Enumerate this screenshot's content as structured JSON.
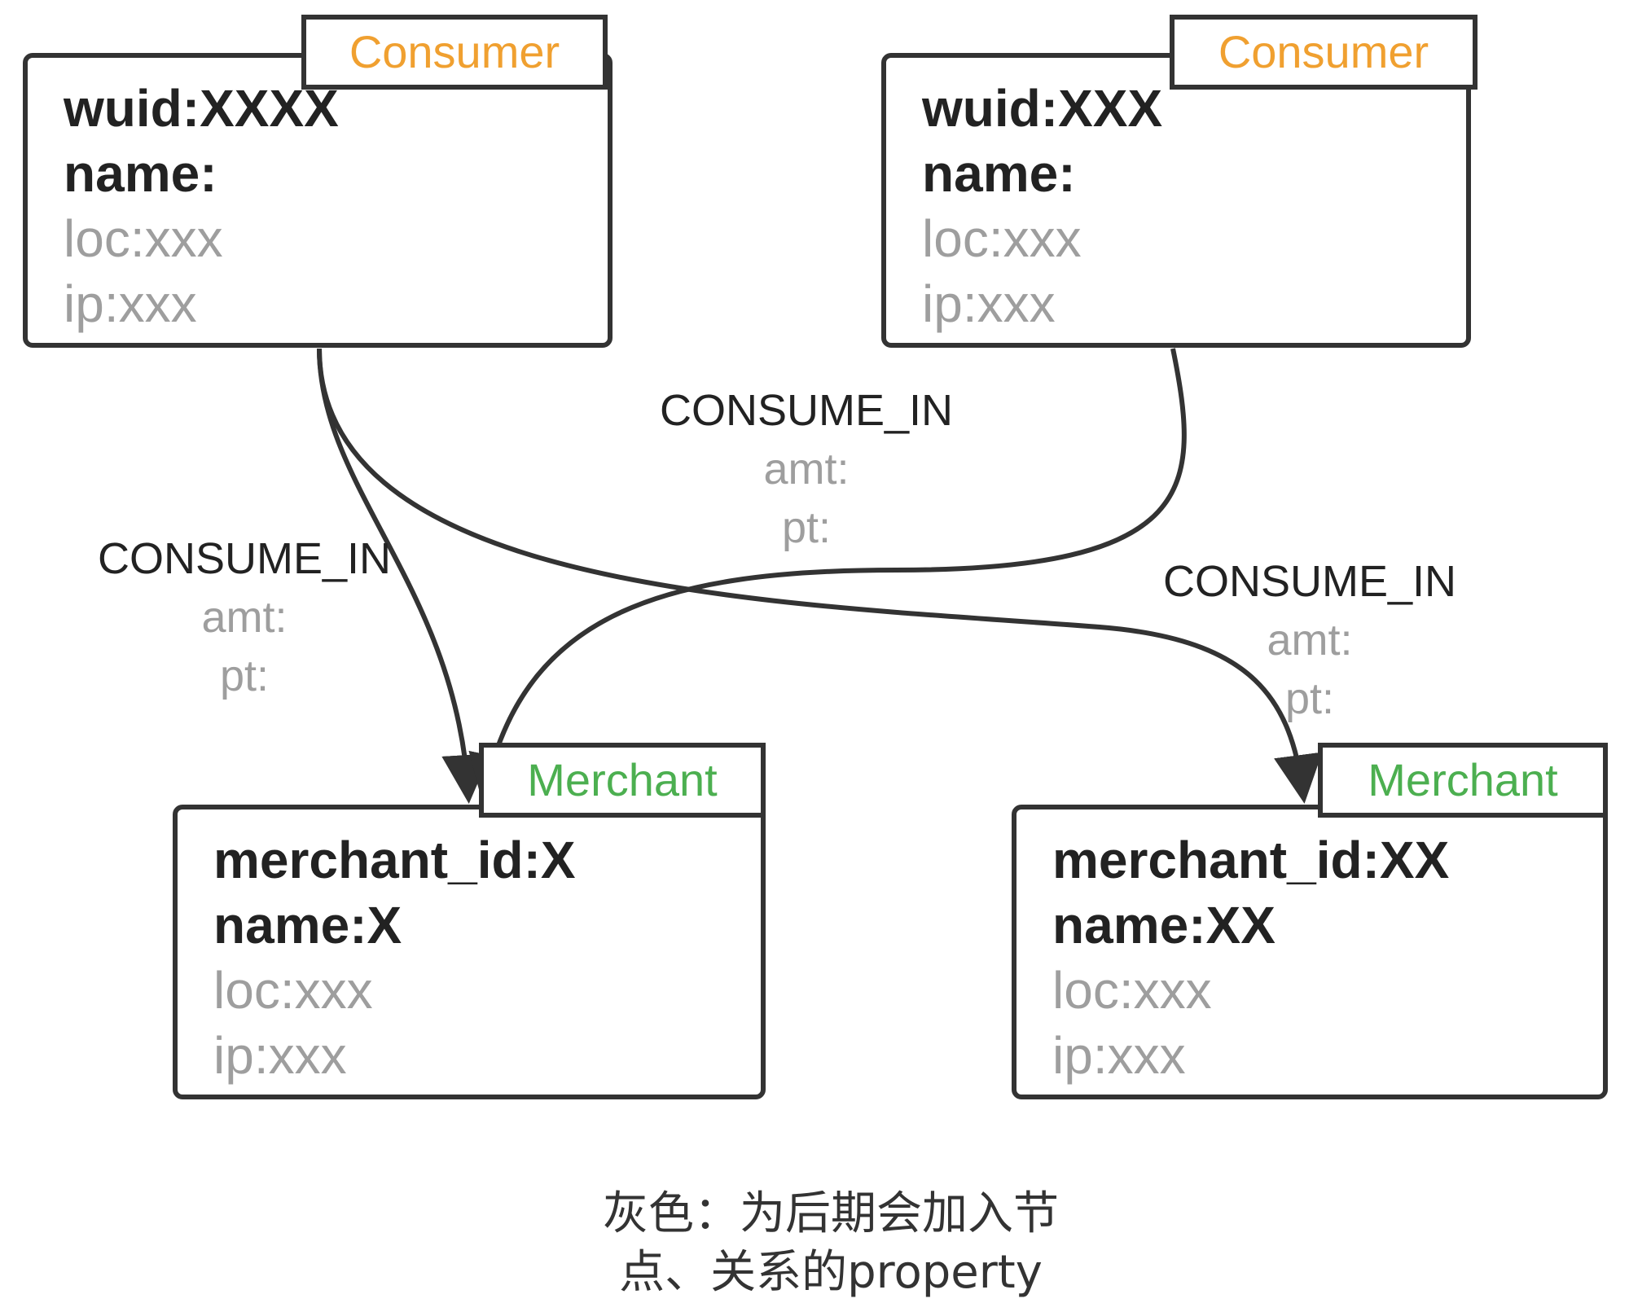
{
  "nodes": {
    "consumer_a": {
      "tag": "Consumer",
      "fields": [
        "wuid:XXXX",
        "name:",
        "loc:xxx",
        "ip:xxx"
      ]
    },
    "consumer_b": {
      "tag": "Consumer",
      "fields": [
        "wuid:XXX",
        "name:",
        "loc:xxx",
        "ip:xxx"
      ]
    },
    "merchant_a": {
      "tag": "Merchant",
      "fields": [
        "merchant_id:X",
        "name:X",
        "loc:xxx",
        "ip:xxx"
      ]
    },
    "merchant_b": {
      "tag": "Merchant",
      "fields": [
        "merchant_id:XX",
        "name:XX",
        "loc:xxx",
        "ip:xxx"
      ]
    }
  },
  "edges": [
    {
      "from": "Consumer (wuid:XXXX)",
      "to": "Merchant (merchant_id:X)",
      "label": "CONSUME_IN",
      "props": [
        "amt:",
        "pt:"
      ]
    },
    {
      "from": "Consumer (wuid:XXX)",
      "to": "Merchant (merchant_id:X)",
      "label": "CONSUME_IN",
      "props": [
        "amt:",
        "pt:"
      ]
    },
    {
      "from": "Consumer (wuid:XXXX)",
      "to": "Merchant (merchant_id:XX)",
      "label": "CONSUME_IN",
      "props": [
        "amt:",
        "pt:"
      ]
    }
  ],
  "note": {
    "line1": "灰色：为后期会加入节",
    "line2": "点、关系的property"
  },
  "colors": {
    "stroke": "#333333",
    "consumer_tag": "#f0a030",
    "merchant_tag": "#4caf50",
    "core_property_text": "#222222",
    "future_property_text": "#9e9e9e"
  }
}
